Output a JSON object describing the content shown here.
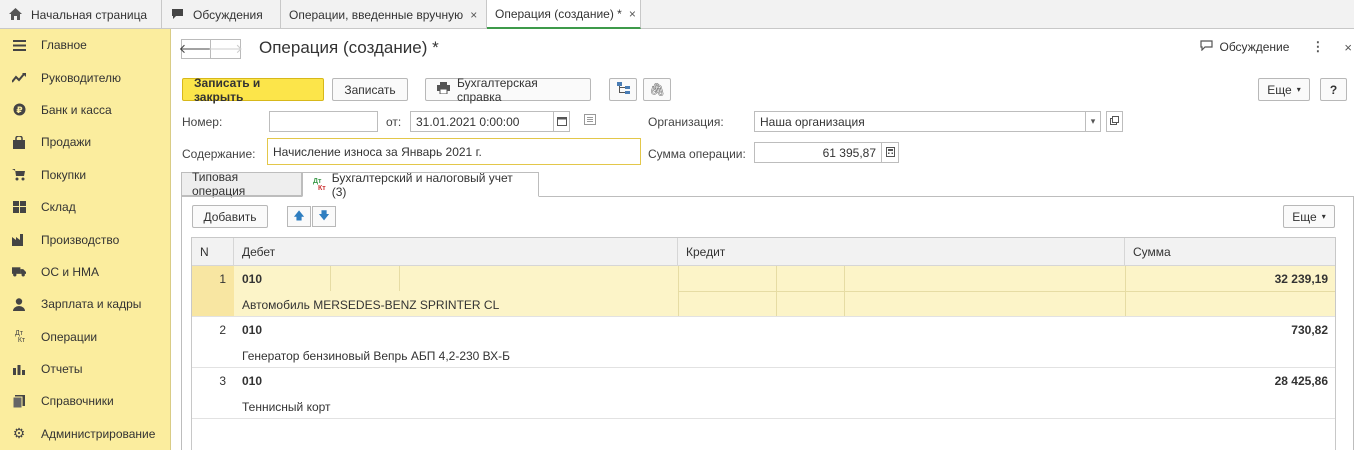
{
  "top_tabs": [
    {
      "label": "Начальная страница",
      "icon": "home-icon"
    },
    {
      "label": "Обсуждения",
      "icon": "chat-icon"
    },
    {
      "label": "Операции, введенные вручную",
      "close": "×"
    },
    {
      "label": "Операция (создание) *",
      "close": "×"
    }
  ],
  "sidebar": {
    "items": [
      {
        "label": "Главное",
        "icon": "menu-icon"
      },
      {
        "label": "Руководителю",
        "icon": "trend-icon"
      },
      {
        "label": "Банк и касса",
        "icon": "coin-icon"
      },
      {
        "label": "Продажи",
        "icon": "bag-icon"
      },
      {
        "label": "Покупки",
        "icon": "cart-icon"
      },
      {
        "label": "Склад",
        "icon": "warehouse-icon"
      },
      {
        "label": "Производство",
        "icon": "factory-icon"
      },
      {
        "label": "ОС и НМА",
        "icon": "truck-icon"
      },
      {
        "label": "Зарплата и кадры",
        "icon": "person-icon"
      },
      {
        "label": "Операции",
        "icon": "dtkt-icon"
      },
      {
        "label": "Отчеты",
        "icon": "bar-chart-icon"
      },
      {
        "label": "Справочники",
        "icon": "books-icon"
      },
      {
        "label": "Администрирование",
        "icon": "gear-icon"
      }
    ]
  },
  "header": {
    "title": "Операция (создание) *",
    "discussion_label": "Обсуждение",
    "kebab": "⋮",
    "close": "×"
  },
  "toolbar": {
    "save_close_label": "Записать и закрыть",
    "save_label": "Записать",
    "report_label": "Бухгалтерская справка",
    "more_label": "Еще",
    "help_label": "?"
  },
  "form": {
    "number_label": "Номер:",
    "number_value": "",
    "date_label": "от:",
    "date_value": "31.01.2021  0:00:00",
    "org_label": "Организация:",
    "org_value": "Наша организация",
    "content_label": "Содержание:",
    "content_value": "Начисление износа за Январь 2021 г.",
    "sum_label": "Сумма операции:",
    "sum_value": "61 395,87"
  },
  "section_tabs": {
    "tab1": "Типовая операция",
    "tab2": "Бухгалтерский и налоговый учет (3)",
    "tab2_icon_top": "Дт",
    "tab2_icon_bottom": "Кт"
  },
  "table_toolbar": {
    "add_label": "Добавить",
    "more_label": "Еще"
  },
  "table": {
    "headers": {
      "n": "N",
      "debit": "Дебет",
      "credit": "Кредит",
      "sum": "Сумма"
    },
    "rows": [
      {
        "n": "1",
        "account": "010",
        "desc": "Автомобиль MERSEDES-BENZ SPRINTER CL",
        "sum": "32 239,19"
      },
      {
        "n": "2",
        "account": "010",
        "desc": "Генератор бензиновый Вепрь АБП 4,2-230 ВХ-Б",
        "sum": "730,82"
      },
      {
        "n": "3",
        "account": "010",
        "desc": "Теннисный корт",
        "sum": "28 425,86"
      }
    ]
  },
  "colors": {
    "sidebar_bg": "#fbed9e",
    "primary_button": "#fce54a",
    "active_tab_underline": "#3d9a4a",
    "selected_row": "#fcf4c8",
    "arrow_blue": "#2f7ec0"
  }
}
